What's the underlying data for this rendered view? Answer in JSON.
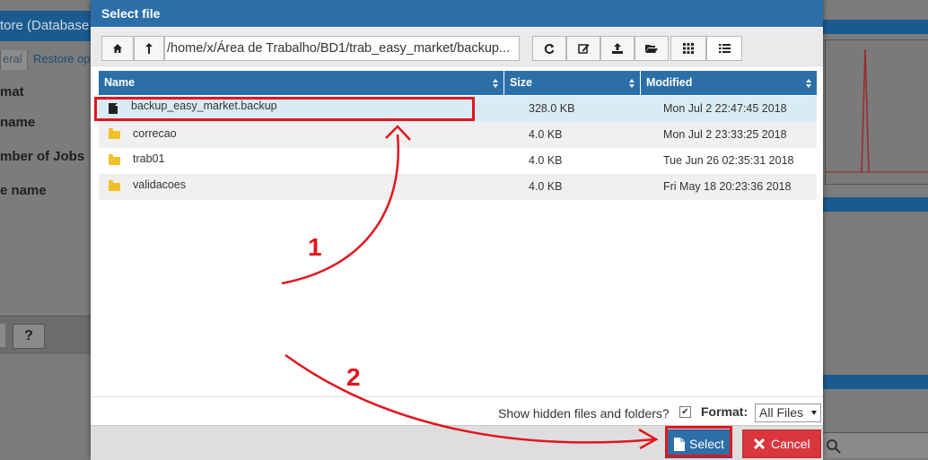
{
  "background": {
    "left_title": "tore (Database:",
    "tab_general": "eral",
    "tab_restore": "Restore op",
    "labels": [
      "mat",
      "name",
      "mber of Jobs",
      "e name"
    ],
    "help_label": "?"
  },
  "dialog": {
    "title": "Select file",
    "path": "/home/x/Área de Trabalho/BD1/trab_easy_market/backup...",
    "toolbar": {
      "home_icon": "home-icon",
      "up_icon": "level-up-icon",
      "refresh_icon": "refresh-icon",
      "rename_icon": "edit-icon",
      "upload_icon": "upload-icon",
      "new_folder_icon": "folder-open-icon",
      "grid_view_icon": "grid-icon",
      "list_view_icon": "list-icon"
    },
    "columns": [
      {
        "label": "Name"
      },
      {
        "label": "Size"
      },
      {
        "label": "Modified"
      }
    ],
    "files": [
      {
        "icon": "file-icon",
        "name": "backup_easy_market.backup",
        "size": "328.0 KB",
        "modified": "Mon Jul 2 22:47:45 2018",
        "selected": true
      },
      {
        "icon": "folder-icon",
        "name": "correcao",
        "size": "4.0 KB",
        "modified": "Mon Jul 2 23:33:25 2018",
        "selected": false
      },
      {
        "icon": "folder-icon",
        "name": "trab01",
        "size": "4.0 KB",
        "modified": "Tue Jun 26 02:35:31 2018",
        "selected": false
      },
      {
        "icon": "folder-icon",
        "name": "validacoes",
        "size": "4.0 KB",
        "modified": "Fri May 18 20:23:36 2018",
        "selected": false
      }
    ],
    "show_hidden_label": "Show hidden files and folders?",
    "show_hidden_checked": true,
    "format_label": "Format:",
    "format_value": "All Files",
    "select_label": "Select",
    "cancel_label": "Cancel"
  },
  "annotations": {
    "step1": "1",
    "step2": "2",
    "highlight_color": "#e2161d"
  },
  "colors": {
    "header_blue": "#2c6fa8",
    "selected_row": "#d9ecf5",
    "cancel_red": "#d9363e"
  }
}
